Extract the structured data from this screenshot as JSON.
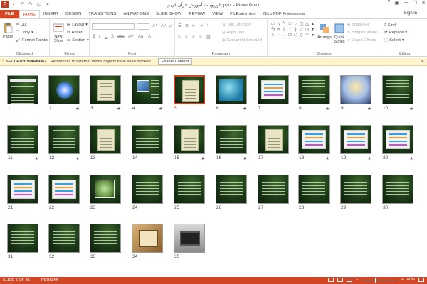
{
  "window": {
    "title": "پاورپوینت آموزش قرآن کریم.pptx - PowerPoint",
    "sign_in": "Sign in"
  },
  "tabs": [
    {
      "label": "FILE",
      "name": "tab-file"
    },
    {
      "label": "HOME",
      "name": "tab-home"
    },
    {
      "label": "INSERT",
      "name": "tab-insert"
    },
    {
      "label": "DESIGN",
      "name": "tab-design"
    },
    {
      "label": "TRANSITIONS",
      "name": "tab-transitions"
    },
    {
      "label": "ANIMATIONS",
      "name": "tab-animations"
    },
    {
      "label": "SLIDE SHOW",
      "name": "tab-slide-show"
    },
    {
      "label": "REVIEW",
      "name": "tab-review"
    },
    {
      "label": "VIEW",
      "name": "tab-view"
    },
    {
      "label": "FILEminimizer",
      "name": "tab-fileminimizer"
    },
    {
      "label": "Nitro PDF Professional",
      "name": "tab-nitro-pdf"
    }
  ],
  "active_tab": "HOME",
  "ribbon": {
    "clipboard": {
      "label": "Clipboard",
      "paste": "Paste",
      "cut": "Cut",
      "copy": "Copy",
      "format_painter": "Format Painter"
    },
    "slides": {
      "label": "Slides",
      "new_slide": "New Slide",
      "layout": "Layout",
      "reset": "Reset",
      "section": "Section"
    },
    "font": {
      "label": "Font"
    },
    "paragraph": {
      "label": "Paragraph",
      "text_direction": "Text Direction",
      "align_text": "Align Text",
      "convert_smartart": "Convert to SmartArt"
    },
    "drawing": {
      "label": "Drawing",
      "arrange": "Arrange",
      "quick_styles": "Quick Styles",
      "shape_fill": "Shape Fill",
      "shape_outline": "Shape Outline",
      "shape_effects": "Shape Effects"
    },
    "editing": {
      "label": "Editing",
      "find": "Find",
      "replace": "Replace",
      "select": "Select"
    }
  },
  "security": {
    "title": "SECURITY WARNING",
    "message": "References to external media objects have been blocked",
    "button": "Enable Content"
  },
  "slides": [
    {
      "n": "1",
      "star": false,
      "style": "title"
    },
    {
      "n": "2",
      "star": true,
      "style": "flower"
    },
    {
      "n": "3",
      "star": true,
      "style": "paper"
    },
    {
      "n": "4",
      "star": true,
      "style": "pic"
    },
    {
      "n": "5",
      "star": false,
      "style": "paper"
    },
    {
      "n": "6",
      "star": true,
      "style": "tealbox"
    },
    {
      "n": "7",
      "star": false,
      "style": "whitebox"
    },
    {
      "n": "8",
      "star": true,
      "style": "lines"
    },
    {
      "n": "9",
      "star": true,
      "style": "sunrise"
    },
    {
      "n": "10",
      "star": true,
      "style": "lines"
    },
    {
      "n": "11",
      "star": true,
      "style": "lines"
    },
    {
      "n": "12",
      "star": true,
      "style": "lines"
    },
    {
      "n": "13",
      "star": false,
      "style": "paper"
    },
    {
      "n": "14",
      "star": false,
      "style": "lines"
    },
    {
      "n": "15",
      "star": true,
      "style": "paper"
    },
    {
      "n": "16",
      "star": true,
      "style": "lines"
    },
    {
      "n": "17",
      "star": false,
      "style": "paper"
    },
    {
      "n": "18",
      "star": true,
      "style": "whitebox"
    },
    {
      "n": "19",
      "star": true,
      "style": "whitebox"
    },
    {
      "n": "20",
      "star": true,
      "style": "whitebox"
    },
    {
      "n": "21",
      "star": false,
      "style": "whitebox"
    },
    {
      "n": "22",
      "star": false,
      "style": "whitebox"
    },
    {
      "n": "23",
      "star": false,
      "style": "tree"
    },
    {
      "n": "24",
      "star": false,
      "style": "lines"
    },
    {
      "n": "25",
      "star": false,
      "style": "lines"
    },
    {
      "n": "26",
      "star": false,
      "style": "lines"
    },
    {
      "n": "27",
      "star": false,
      "style": "lines"
    },
    {
      "n": "28",
      "star": false,
      "style": "lines"
    },
    {
      "n": "29",
      "star": false,
      "style": "lines"
    },
    {
      "n": "30",
      "star": false,
      "style": "lines"
    },
    {
      "n": "31",
      "star": false,
      "style": "lines"
    },
    {
      "n": "32",
      "star": false,
      "style": "lines"
    },
    {
      "n": "33",
      "star": false,
      "style": "lines"
    },
    {
      "n": "34",
      "star": false,
      "style": "gold"
    },
    {
      "n": "35",
      "star": false,
      "style": "laptop"
    }
  ],
  "selected_slide": "5",
  "status": {
    "slide_info": "SLIDE 5 OF 35",
    "language": "PERSIAN",
    "zoom": "40%"
  },
  "colors": {
    "accent": "#d24726",
    "warning_bg": "#fff4ce"
  }
}
